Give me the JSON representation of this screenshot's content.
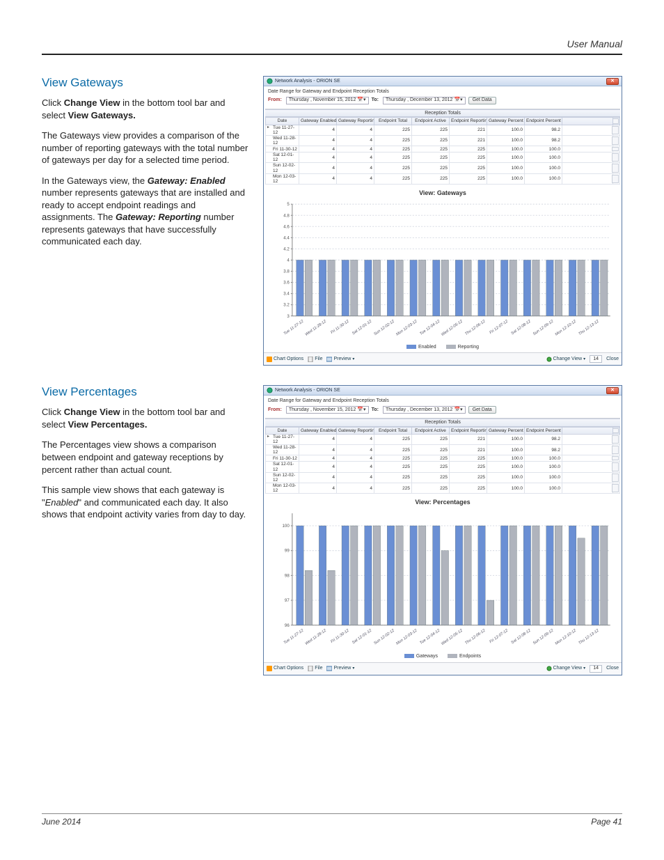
{
  "header": {
    "title": "User Manual"
  },
  "footer": {
    "date": "June 2014",
    "page": "Page 41"
  },
  "sections": {
    "gateways": {
      "heading": "View Gateways",
      "p1a": "Click ",
      "p1b": "Change View",
      "p1c": " in the bottom tool bar and select ",
      "p1d": "View Gateways.",
      "p2": "The Gateways view provides a comparison of the number of reporting gateways with the total number of gateways per day for a selected time period.",
      "p3a": "In the Gateways view, the ",
      "p3b": "Gateway: Enabled",
      "p3c": " number represents gateways that are installed and ready to accept endpoint readings and assignments. The ",
      "p3d": "Gateway: Reporting",
      "p3e": " number represents gateways that have successfully communicated each day."
    },
    "percentages": {
      "heading": "View Percentages",
      "p1a": "Click ",
      "p1b": "Change View",
      "p1c": " in the bottom tool bar and select ",
      "p1d": "View Percentages.",
      "p2": "The Percentages view shows a comparison between endpoint and gateway receptions by percent rather than actual count.",
      "p3a": "This sample view shows that each gateway is \"",
      "p3b": "Enabled",
      "p3c": "\" and communicated each day. It also shows that endpoint activity varies from day to day."
    }
  },
  "app": {
    "title": "Network Analysis - ORION SE",
    "desc": "Date Range for Gateway and Endpoint Reception Totals",
    "from_label": "From:",
    "to_label": "To:",
    "from_date": "Thursday , November 15, 2012",
    "to_date": "Thursday , December 13, 2012",
    "get_data": "Get Data",
    "band": "Reception Totals",
    "cols": [
      "Date",
      "Gateway Enabled",
      "Gateway Reporting",
      "Endpoint Total",
      "Endpoint Active",
      "Endpoint Reporting",
      "Gateway Percent",
      "Endpoint Percent"
    ],
    "bottom": {
      "chart_options": "Chart Options",
      "file": "File",
      "preview": "Preview",
      "change_view": "Change View",
      "refresh_num": "14",
      "close": "Close"
    }
  },
  "chart_data": [
    {
      "type": "bar",
      "title": "View: Gateways",
      "xlabel": "",
      "ylabel": "",
      "ylim": [
        3,
        5
      ],
      "yticks": [
        3,
        3.2,
        3.4,
        3.6,
        3.8,
        4,
        4.2,
        4.4,
        4.6,
        4.8,
        5
      ],
      "categories": [
        "Tue 11-27-12",
        "Wed 11-28-12",
        "Fri 11-30-12",
        "Sat 12-01-12",
        "Sun 12-02-12",
        "Mon 12-03-12",
        "Tue 12-04-12",
        "Wed 12-05-12",
        "Thu 12-06-12",
        "Fri 12-07-12",
        "Sat 12-08-12",
        "Sun 12-09-12",
        "Mon 12-10-12",
        "Thu 12-13-12"
      ],
      "series": [
        {
          "name": "Enabled",
          "color": "#6a8fd4",
          "values": [
            4,
            4,
            4,
            4,
            4,
            4,
            4,
            4,
            4,
            4,
            4,
            4,
            4,
            4
          ]
        },
        {
          "name": "Reporting",
          "color": "#b0b4bd",
          "values": [
            4,
            4,
            4,
            4,
            4,
            4,
            4,
            4,
            4,
            4,
            4,
            4,
            4,
            4
          ]
        }
      ],
      "table_rows": [
        {
          "date": "Tue 11-27-12",
          "ge": 4,
          "gr": 4,
          "et": 225,
          "ea": 225,
          "er": 221,
          "gp": "100.0",
          "ep": "98.2"
        },
        {
          "date": "Wed 11-28-12",
          "ge": 4,
          "gr": 4,
          "et": 225,
          "ea": 225,
          "er": 221,
          "gp": "100.0",
          "ep": "98.2"
        },
        {
          "date": "Fri 11-30-12",
          "ge": 4,
          "gr": 4,
          "et": 225,
          "ea": 225,
          "er": 225,
          "gp": "100.0",
          "ep": "100.0"
        },
        {
          "date": "Sat 12-01-12",
          "ge": 4,
          "gr": 4,
          "et": 225,
          "ea": 225,
          "er": 225,
          "gp": "100.0",
          "ep": "100.0"
        },
        {
          "date": "Sun 12-02-12",
          "ge": 4,
          "gr": 4,
          "et": 225,
          "ea": 225,
          "er": 225,
          "gp": "100.0",
          "ep": "100.0"
        },
        {
          "date": "Mon 12-03-12",
          "ge": 4,
          "gr": 4,
          "et": 225,
          "ea": 225,
          "er": 225,
          "gp": "100.0",
          "ep": "100.0"
        }
      ]
    },
    {
      "type": "bar",
      "title": "View: Percentages",
      "xlabel": "",
      "ylabel": "",
      "ylim": [
        96,
        100.5
      ],
      "yticks": [
        96,
        97,
        98,
        99,
        100
      ],
      "categories": [
        "Tue 11-27-12",
        "Wed 11-28-12",
        "Fri 11-30-12",
        "Sat 12-01-12",
        "Sun 12-02-12",
        "Mon 12-03-12",
        "Tue 12-04-12",
        "Wed 12-05-12",
        "Thu 12-06-12",
        "Fri 12-07-12",
        "Sat 12-08-12",
        "Sun 12-09-12",
        "Mon 12-10-12",
        "Thu 12-13-12"
      ],
      "series": [
        {
          "name": "Gateways",
          "color": "#6a8fd4",
          "values": [
            100,
            100,
            100,
            100,
            100,
            100,
            100,
            100,
            100,
            100,
            100,
            100,
            100,
            100
          ]
        },
        {
          "name": "Endpoints",
          "color": "#b0b4bd",
          "values": [
            98.2,
            98.2,
            100,
            100,
            100,
            100,
            99,
            100,
            97,
            100,
            100,
            100,
            99.5,
            100
          ]
        }
      ],
      "table_rows": [
        {
          "date": "Tue 11-27-12",
          "ge": 4,
          "gr": 4,
          "et": 225,
          "ea": 225,
          "er": 221,
          "gp": "100.0",
          "ep": "98.2"
        },
        {
          "date": "Wed 11-28-12",
          "ge": 4,
          "gr": 4,
          "et": 225,
          "ea": 225,
          "er": 221,
          "gp": "100.0",
          "ep": "98.2"
        },
        {
          "date": "Fri 11-30-12",
          "ge": 4,
          "gr": 4,
          "et": 225,
          "ea": 225,
          "er": 225,
          "gp": "100.0",
          "ep": "100.0"
        },
        {
          "date": "Sat 12-01-12",
          "ge": 4,
          "gr": 4,
          "et": 225,
          "ea": 225,
          "er": 225,
          "gp": "100.0",
          "ep": "100.0"
        },
        {
          "date": "Sun 12-02-12",
          "ge": 4,
          "gr": 4,
          "et": 225,
          "ea": 225,
          "er": 225,
          "gp": "100.0",
          "ep": "100.0"
        },
        {
          "date": "Mon 12-03-12",
          "ge": 4,
          "gr": 4,
          "et": 225,
          "ea": 225,
          "er": 225,
          "gp": "100.0",
          "ep": "100.0"
        }
      ]
    }
  ]
}
